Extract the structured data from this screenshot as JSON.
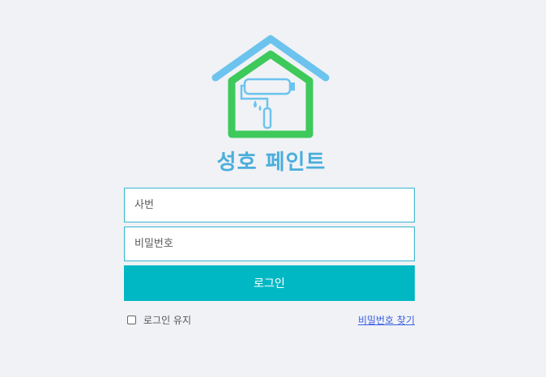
{
  "brand": {
    "name": "성호 페인트",
    "logo_icon": "house-paint-roller-icon",
    "roof_color": "#6cc3ee",
    "house_color": "#3ec95b",
    "roller_color": "#6cc3ee",
    "text_color": "#4aaedc"
  },
  "form": {
    "id_placeholder": "사번",
    "password_placeholder": "비밀번호",
    "login_label": "로그인",
    "login_color": "#00b8c4",
    "remember_label": "로그인 유지",
    "remember_checked": false,
    "find_password_label": "비밀번호 찾기"
  }
}
